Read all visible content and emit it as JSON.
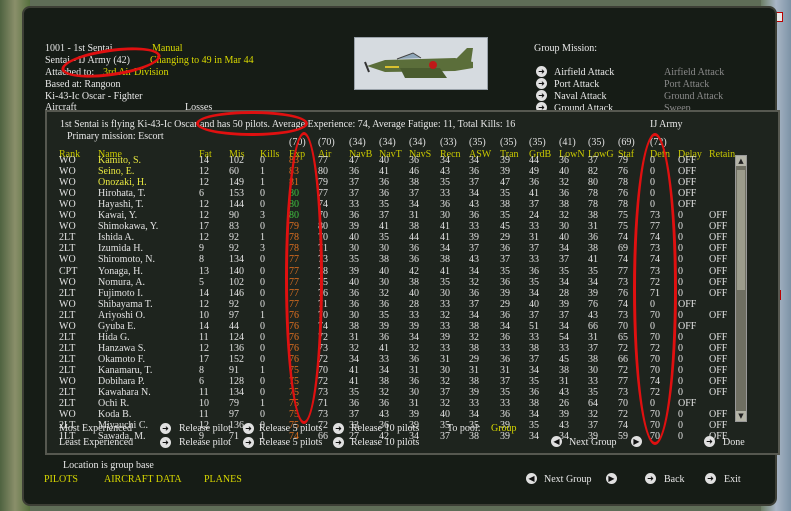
{
  "unit": {
    "line1_prefix": "1001 - 1st Sentai",
    "line1_status": "Manual",
    "line2_prefix": "Sentai - IJ Army (42)",
    "line2_status": "Changing to 49 in Mar 44",
    "attached_label": "Attached to:",
    "attached_value": "3rd Air Division",
    "based_at": "Based at: Rangoon",
    "aircraft_type": "Ki-43-Ic Oscar - Fighter",
    "aircraft_label": "Aircraft",
    "losses_label": "Losses"
  },
  "group_mission": {
    "title": "Group Mission:",
    "options": [
      "Airfield Attack",
      "Port Attack",
      "Naval Attack",
      "Ground Attack"
    ],
    "values": [
      "Airfield Attack",
      "Port Attack",
      "Ground Attack",
      "Sweep"
    ]
  },
  "summary": {
    "text": "1st Sentai is flying Ki-43-Ic Oscar and has 50 pilots. Average Experience: 74, Average Fatigue: 11, Total Kills: 16",
    "service": "IJ Army",
    "primary_mission": "Primary mission: Escort"
  },
  "columns": {
    "headers": [
      "Rank",
      "Name",
      "Fat",
      "Mis",
      "Kills",
      "Exp",
      "Air",
      "NavB",
      "NavT",
      "NavS",
      "Recn",
      "ASW",
      "Tran",
      "GrdB",
      "LowN",
      "LowG",
      "Staf",
      "Defn",
      "Delay",
      "Retain"
    ],
    "counts": [
      "",
      "",
      "",
      "",
      "",
      "(70)",
      "(70)",
      "(34)",
      "(34)",
      "(34)",
      "(33)",
      "(35)",
      "(35)",
      "(35)",
      "(41)",
      "(35)",
      "(69)",
      "(72)",
      "",
      ""
    ]
  },
  "pilots": [
    [
      "WO",
      "Kamito, S.",
      "14",
      "102",
      "0",
      "83",
      "77",
      "47",
      "40",
      "36",
      "34",
      "34",
      "39",
      "44",
      "36",
      "37",
      "79",
      "0",
      "OFF"
    ],
    [
      "WO",
      "Seino, E.",
      "12",
      "60",
      "1",
      "83",
      "80",
      "36",
      "41",
      "46",
      "43",
      "36",
      "39",
      "49",
      "40",
      "82",
      "76",
      "0",
      "OFF"
    ],
    [
      "WO",
      "Onozaki, H.",
      "12",
      "149",
      "1",
      "81",
      "79",
      "37",
      "36",
      "38",
      "35",
      "37",
      "47",
      "36",
      "32",
      "80",
      "78",
      "0",
      "OFF"
    ],
    [
      "WO",
      "Hirohata, T.",
      "6",
      "153",
      "0",
      "80",
      "77",
      "37",
      "36",
      "37",
      "33",
      "34",
      "35",
      "41",
      "36",
      "78",
      "76",
      "0",
      "OFF"
    ],
    [
      "WO",
      "Hayashi, T.",
      "12",
      "144",
      "0",
      "80",
      "74",
      "33",
      "35",
      "34",
      "36",
      "43",
      "38",
      "37",
      "38",
      "78",
      "78",
      "0",
      "OFF"
    ],
    [
      "WO",
      "Kawai, Y.",
      "12",
      "90",
      "3",
      "80",
      "70",
      "36",
      "37",
      "31",
      "30",
      "36",
      "35",
      "24",
      "32",
      "38",
      "75",
      "73",
      "0",
      "OFF"
    ],
    [
      "WO",
      "Shimokawa, Y.",
      "17",
      "83",
      "0",
      "79",
      "80",
      "39",
      "41",
      "38",
      "41",
      "33",
      "45",
      "33",
      "30",
      "31",
      "75",
      "77",
      "0",
      "OFF"
    ],
    [
      "2LT",
      "Ishida A.",
      "12",
      "92",
      "1",
      "78",
      "70",
      "40",
      "35",
      "44",
      "41",
      "39",
      "29",
      "31",
      "40",
      "36",
      "74",
      "74",
      "0",
      "OFF"
    ],
    [
      "2LT",
      "Izumida H.",
      "9",
      "92",
      "3",
      "78",
      "71",
      "30",
      "30",
      "36",
      "34",
      "37",
      "36",
      "37",
      "34",
      "38",
      "69",
      "73",
      "0",
      "OFF"
    ],
    [
      "WO",
      "Shiromoto, N.",
      "8",
      "134",
      "0",
      "77",
      "73",
      "35",
      "38",
      "36",
      "38",
      "43",
      "37",
      "33",
      "37",
      "41",
      "74",
      "74",
      "0",
      "OFF"
    ],
    [
      "CPT",
      "Yonaga, H.",
      "13",
      "140",
      "0",
      "77",
      "78",
      "39",
      "40",
      "42",
      "41",
      "34",
      "35",
      "36",
      "35",
      "35",
      "77",
      "73",
      "0",
      "OFF"
    ],
    [
      "WO",
      "Nomura, A.",
      "5",
      "102",
      "0",
      "77",
      "75",
      "40",
      "30",
      "38",
      "35",
      "32",
      "36",
      "35",
      "34",
      "34",
      "73",
      "72",
      "0",
      "OFF"
    ],
    [
      "2LT",
      "Fujimoto I.",
      "14",
      "146",
      "0",
      "77",
      "76",
      "36",
      "32",
      "40",
      "30",
      "36",
      "39",
      "34",
      "28",
      "39",
      "76",
      "71",
      "0",
      "OFF"
    ],
    [
      "WO",
      "Shibayama T.",
      "12",
      "92",
      "0",
      "77",
      "71",
      "36",
      "36",
      "28",
      "33",
      "37",
      "29",
      "40",
      "39",
      "76",
      "74",
      "0",
      "OFF"
    ],
    [
      "2LT",
      "Ariyoshi O.",
      "10",
      "97",
      "1",
      "76",
      "70",
      "30",
      "35",
      "33",
      "32",
      "34",
      "36",
      "37",
      "37",
      "43",
      "73",
      "70",
      "0",
      "OFF"
    ],
    [
      "WO",
      "Gyuba E.",
      "14",
      "44",
      "0",
      "76",
      "74",
      "38",
      "39",
      "39",
      "33",
      "38",
      "34",
      "51",
      "34",
      "66",
      "70",
      "0",
      "OFF"
    ],
    [
      "2LT",
      "Hida G.",
      "11",
      "124",
      "0",
      "76",
      "72",
      "31",
      "36",
      "34",
      "39",
      "32",
      "36",
      "33",
      "54",
      "31",
      "65",
      "70",
      "0",
      "OFF"
    ],
    [
      "2LT",
      "Hanzawa S.",
      "12",
      "136",
      "0",
      "76",
      "73",
      "32",
      "41",
      "32",
      "33",
      "38",
      "33",
      "38",
      "33",
      "37",
      "72",
      "72",
      "0",
      "OFF"
    ],
    [
      "2LT",
      "Okamoto F.",
      "17",
      "152",
      "0",
      "76",
      "72",
      "34",
      "33",
      "36",
      "31",
      "29",
      "36",
      "37",
      "45",
      "38",
      "66",
      "70",
      "0",
      "OFF"
    ],
    [
      "2LT",
      "Kanamaru, T.",
      "8",
      "91",
      "1",
      "75",
      "70",
      "41",
      "34",
      "31",
      "30",
      "31",
      "31",
      "34",
      "38",
      "30",
      "72",
      "70",
      "0",
      "OFF"
    ],
    [
      "WO",
      "Dobihara P.",
      "6",
      "128",
      "0",
      "75",
      "72",
      "41",
      "38",
      "36",
      "32",
      "38",
      "37",
      "35",
      "31",
      "33",
      "77",
      "74",
      "0",
      "OFF"
    ],
    [
      "2LT",
      "Kawahara N.",
      "11",
      "134",
      "0",
      "75",
      "73",
      "35",
      "32",
      "30",
      "37",
      "39",
      "35",
      "36",
      "43",
      "35",
      "73",
      "72",
      "0",
      "OFF"
    ],
    [
      "2LT",
      "Ochi R.",
      "10",
      "79",
      "1",
      "75",
      "71",
      "36",
      "36",
      "31",
      "32",
      "33",
      "33",
      "38",
      "26",
      "64",
      "70",
      "0",
      "OFF"
    ],
    [
      "WO",
      "Koda B.",
      "11",
      "97",
      "0",
      "75",
      "73",
      "37",
      "43",
      "39",
      "40",
      "34",
      "36",
      "34",
      "39",
      "32",
      "72",
      "70",
      "0",
      "OFF"
    ],
    [
      "2LT",
      "Miyauchi C.",
      "12",
      "136",
      "0",
      "75",
      "72",
      "33",
      "36",
      "39",
      "35",
      "35",
      "39",
      "35",
      "43",
      "37",
      "74",
      "70",
      "0",
      "OFF"
    ],
    [
      "1LT",
      "Sawada, M.",
      "9",
      "71",
      "1",
      "74",
      "66",
      "27",
      "42",
      "34",
      "37",
      "38",
      "39",
      "34",
      "34",
      "39",
      "59",
      "70",
      "0",
      "OFF"
    ]
  ],
  "controls": {
    "most_experienced": "Most Experienced",
    "least_experienced": "Least Experienced",
    "release_pilot": "Release pilot",
    "release_5": "Release 5 pilots",
    "release_10": "Release 10 pilots",
    "to_pool_label": "To pool:",
    "to_pool_value": "Group",
    "next_group": "Next Group",
    "done": "Done"
  },
  "footer": {
    "location_note": "Location is group base",
    "pilots_tab": "PILOTS",
    "aircraft_data_tab": "AIRCRAFT DATA",
    "planes_tab": "PLANES",
    "next_group": "Next Group",
    "back": "Back",
    "exit": "Exit"
  },
  "colors": {
    "accent_yellow": "#d8d800",
    "highlight_orange": "#e07020",
    "highlight_green": "#40c040",
    "annotation_red": "#e01010"
  }
}
